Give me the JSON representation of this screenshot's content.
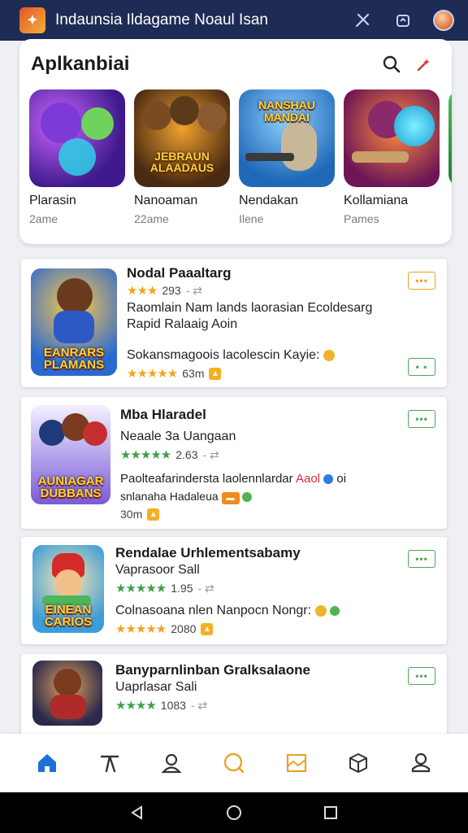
{
  "topbar": {
    "title": "Indaunsia Ildagame  Noaul Isan",
    "icons": [
      "app-logo",
      "tools-icon",
      "share-icon",
      "avatar"
    ]
  },
  "featured": {
    "title": "Aplkanbiai",
    "icons": [
      "search-icon",
      "sparkle-icon"
    ],
    "games": [
      {
        "name": "Plarasin",
        "sub": "2ame",
        "art_title": ""
      },
      {
        "name": "Nanoaman",
        "sub": "22ame",
        "art_title": "JEBRAUN ALAADAUS"
      },
      {
        "name": "Nendakan",
        "sub": "Ilene",
        "art_title": "NANSHAU MANDAI"
      },
      {
        "name": "Kollamiana",
        "sub": "Pames",
        "art_title": ""
      }
    ]
  },
  "list": [
    {
      "title": "Nodal Paaaltarg",
      "stars": "★★★",
      "rating": "293",
      "desc1": "Raomlain Nam lands laorasian Ecoldesarg",
      "desc2": "Rapid Ralaaig Aoin",
      "note": "Sokansmagoois lacolescin Kayie:",
      "meta_stars": "★★★★★",
      "meta": "63m",
      "art_title": "EANRARS PLAMANS"
    },
    {
      "title": "Mba Hlaradel",
      "stars": "★★★★★",
      "rating": "2.63",
      "subtitle": "Neaale 3a Uangaan",
      "desc1": "Paolteafarindersta laolennlardar",
      "desc1_highlight": "Aaol",
      "desc1_tail": "oi",
      "desc2": "snlanaha Hadaleua",
      "meta": "30m",
      "art_title": "AUNIAGAR DUBBANS"
    },
    {
      "title": "Rendalae Urhlementsabamy",
      "subtitle": "Vaprasoor Sall",
      "stars": "★★★★★",
      "rating": "1.95",
      "desc1": "Colnasoana nlen Nanpocn Nongr:",
      "meta_stars": "★★★★★",
      "meta": "2080",
      "art_title": "EINEAN CARIOS"
    },
    {
      "title": "Banyparnlinban Gralksalaone",
      "subtitle": "Uaprlasar Sali",
      "stars": "★★★★",
      "rating": "1083",
      "art_title": ""
    }
  ],
  "more_label": "•••",
  "nav": [
    "home-icon",
    "trending-icon",
    "profile-icon",
    "search-icon",
    "library-icon",
    "box-icon",
    "account-icon"
  ],
  "colors": {
    "topbar": "#1d2b55",
    "accent_orange": "#f0a023",
    "accent_green": "#4fa858",
    "nav_active": "#1f6fd8"
  }
}
